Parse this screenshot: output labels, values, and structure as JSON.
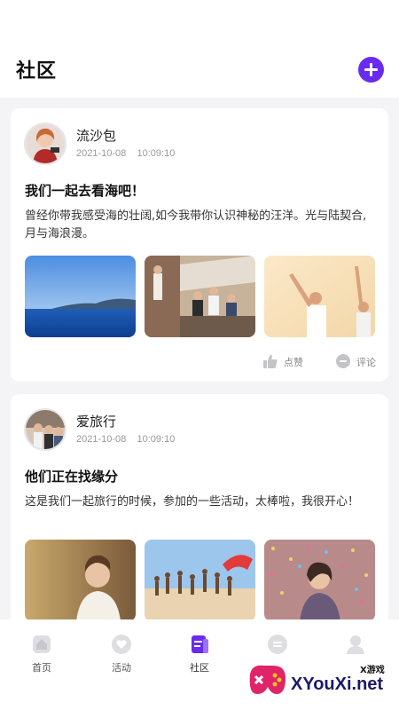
{
  "header": {
    "title": "社区"
  },
  "posts": [
    {
      "author": "流沙包",
      "date": "2021-10-08",
      "time": "10:09:10",
      "title": "我们一起去看海吧！",
      "body": "曾经你带我感受海的壮阔,如今我带你认识神秘的汪洋。光与陆契合,月与海浪漫。",
      "like_label": "点赞",
      "comment_label": "评论"
    },
    {
      "author": "爱旅行",
      "date": "2021-10-08",
      "time": "10:09:10",
      "title": "他们正在找缘分",
      "body": "这是我们一起旅行的时候，参加的一些活动，太棒啦，我很开心！"
    }
  ],
  "tabbar": {
    "items": [
      {
        "label": "首页",
        "icon": "home-icon"
      },
      {
        "label": "活动",
        "icon": "heart-icon"
      },
      {
        "label": "社区",
        "icon": "community-icon",
        "active": true
      },
      {
        "label": "",
        "icon": "message-icon"
      },
      {
        "label": "",
        "icon": "user-icon"
      }
    ]
  },
  "watermark": {
    "small": "X游戏",
    "big": "XYouXi.net"
  },
  "colors": {
    "accent": "#6a2bf0",
    "background": "#f4f4f6"
  }
}
